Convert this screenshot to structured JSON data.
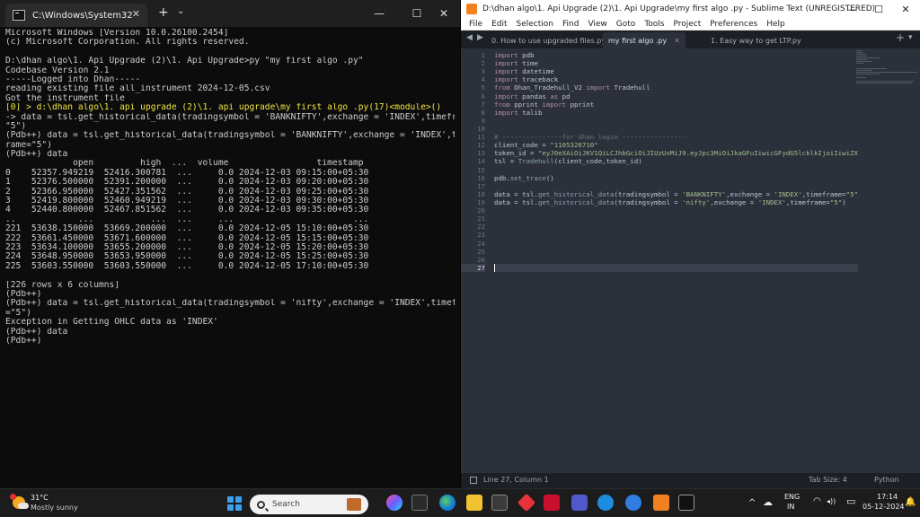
{
  "cmd": {
    "tab_title": "C:\\Windows\\System32\\cmd.e",
    "close_glyph": "✕",
    "plus_glyph": "+",
    "dropdown_glyph": "⌄",
    "minimize_glyph": "—",
    "maximize_glyph": "☐",
    "window_close_glyph": "✕",
    "lines": [
      "Microsoft Windows [Version 10.0.26100.2454]",
      "(c) Microsoft Corporation. All rights reserved.",
      "",
      "D:\\dhan algo\\1. Api Upgrade (2)\\1. Api Upgrade>py \"my first algo .py\"",
      "Codebase Version 2.1",
      "-----Logged into Dhan-----",
      "reading existing file all_instrument 2024-12-05.csv",
      "Got the instrument file",
      "[0] > d:\\dhan algo\\1. api upgrade (2)\\1. api upgrade\\my first algo .py(17)<module>()",
      "-> data = tsl.get_historical_data(tradingsymbol = 'BANKNIFTY',exchange = 'INDEX',timeframe=",
      "\"5\")",
      "(Pdb++) data = tsl.get_historical_data(tradingsymbol = 'BANKNIFTY',exchange = 'INDEX',timef",
      "rame=\"5\")",
      "(Pdb++) data",
      "             open         high  ...  volume                 timestamp",
      "0    52357.949219  52416.300781  ...     0.0 2024-12-03 09:15:00+05:30",
      "1    52376.500000  52391.200000  ...     0.0 2024-12-03 09:20:00+05:30",
      "2    52366.950000  52427.351562  ...     0.0 2024-12-03 09:25:00+05:30",
      "3    52419.800000  52460.949219  ...     0.0 2024-12-03 09:30:00+05:30",
      "4    52440.800000  52467.851562  ...     0.0 2024-12-03 09:35:00+05:30",
      "..            ...           ...  ...     ...                       ...",
      "221  53638.150000  53669.200000  ...     0.0 2024-12-05 15:10:00+05:30",
      "222  53661.450000  53671.600000  ...     0.0 2024-12-05 15:15:00+05:30",
      "223  53634.100000  53655.200000  ...     0.0 2024-12-05 15:20:00+05:30",
      "224  53648.950000  53653.950000  ...     0.0 2024-12-05 15:25:00+05:30",
      "225  53603.550000  53603.550000  ...     0.0 2024-12-05 17:10:00+05:30",
      "",
      "[226 rows x 6 columns]",
      "(Pdb++)",
      "(Pdb++) data = tsl.get_historical_data(tradingsymbol = 'nifty',exchange = 'INDEX',timeframe",
      "=\"5\")",
      "Exception in Getting OHLC data as 'INDEX'",
      "(Pdb++) data",
      "(Pdb++)"
    ]
  },
  "sublime": {
    "title": "D:\\dhan algo\\1. Api Upgrade (2)\\1. Api Upgrade\\my first algo .py - Sublime Text (UNREGISTERED)",
    "menu": [
      "File",
      "Edit",
      "Selection",
      "Find",
      "View",
      "Goto",
      "Tools",
      "Project",
      "Preferences",
      "Help"
    ],
    "tabs": [
      {
        "label": "0. How to use upgraded files.py",
        "active": false
      },
      {
        "label": "my first algo .py",
        "active": true
      },
      {
        "label": "1. Easy way to get LTP.py",
        "active": false
      }
    ],
    "tab_close_glyph": "✕",
    "tab_prev_glyph": "◀",
    "tab_next_glyph": "▶",
    "tab_add_glyph": "+",
    "tab_menu_glyph": "▾",
    "current_line": 27,
    "code": [
      [
        {
          "t": "import",
          "c": "kw"
        },
        {
          "t": " pdb"
        }
      ],
      [
        {
          "t": "import",
          "c": "kw"
        },
        {
          "t": " time"
        }
      ],
      [
        {
          "t": "import",
          "c": "kw"
        },
        {
          "t": " datetime"
        }
      ],
      [
        {
          "t": "import",
          "c": "kw"
        },
        {
          "t": " traceback"
        }
      ],
      [
        {
          "t": "from",
          "c": "kw"
        },
        {
          "t": " Dhan_Tradehull_V2 "
        },
        {
          "t": "import",
          "c": "kw"
        },
        {
          "t": " Tradehull"
        }
      ],
      [
        {
          "t": "import",
          "c": "kw"
        },
        {
          "t": " pandas "
        },
        {
          "t": "as",
          "c": "kw"
        },
        {
          "t": " pd"
        }
      ],
      [
        {
          "t": "from",
          "c": "kw"
        },
        {
          "t": " pprint "
        },
        {
          "t": "import",
          "c": "kw"
        },
        {
          "t": " pprint"
        }
      ],
      [
        {
          "t": "import",
          "c": "kw"
        },
        {
          "t": " talib"
        }
      ],
      [],
      [],
      [
        {
          "t": "# ---------------for dhan login ----------------",
          "c": "cm"
        }
      ],
      [
        {
          "t": "client_code = "
        },
        {
          "t": "\"1105326710\"",
          "c": "str"
        }
      ],
      [
        {
          "t": "token_id = "
        },
        {
          "t": "\"eyJ0eXAiOiJKV1QiLCJhbGciOiJIUzUxMiJ9.eyJpc3MiOiJkaGFuIiwicGFydG5lcklkIjoiIiwiZXhwIjoxNzM1",
          "c": "str"
        }
      ],
      [
        {
          "t": "tsl = "
        },
        {
          "t": "Tradehull",
          "c": "fn"
        },
        {
          "t": "(client_code,token_id)"
        }
      ],
      [],
      [
        {
          "t": "pdb."
        },
        {
          "t": "set_trace",
          "c": "fn"
        },
        {
          "t": "()"
        }
      ],
      [],
      [
        {
          "t": "data = tsl."
        },
        {
          "t": "get_historical_data",
          "c": "fn"
        },
        {
          "t": "(tradingsymbol = "
        },
        {
          "t": "'BANKNIFTY'",
          "c": "str"
        },
        {
          "t": ",exchange = "
        },
        {
          "t": "'INDEX'",
          "c": "str"
        },
        {
          "t": ",timeframe="
        },
        {
          "t": "\"5\"",
          "c": "str"
        },
        {
          "t": ")"
        }
      ],
      [
        {
          "t": "data = tsl."
        },
        {
          "t": "get_historical_data",
          "c": "fn"
        },
        {
          "t": "(tradingsymbol = "
        },
        {
          "t": "'nifty'",
          "c": "str"
        },
        {
          "t": ",exchange = "
        },
        {
          "t": "'INDEX'",
          "c": "str"
        },
        {
          "t": ",timeframe="
        },
        {
          "t": "\"5\"",
          "c": "str"
        },
        {
          "t": ")"
        }
      ],
      [],
      [],
      [],
      [],
      [],
      [],
      [],
      []
    ],
    "status_left": "Line 27, Column 1",
    "tab_size": "Tab Size: 4",
    "syntax": "Python"
  },
  "taskbar": {
    "temperature": "31°C",
    "weather": "Mostly sunny",
    "search_label": "Search",
    "lang_line1": "ENG",
    "lang_line2": "IN",
    "time": "17:14",
    "date": "05-12-2024",
    "tray_chevron_glyph": "^",
    "wifi_glyph": "◠",
    "volume_glyph": "◂))",
    "battery_glyph": "▭"
  }
}
